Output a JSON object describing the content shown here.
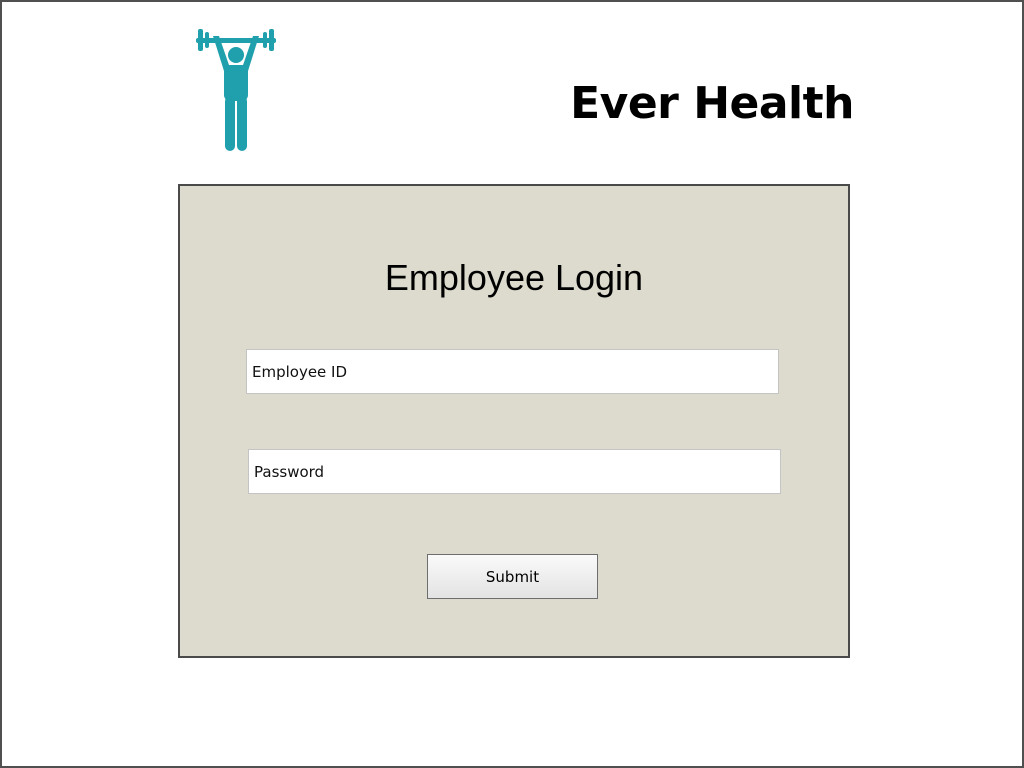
{
  "header": {
    "logo_icon": "weightlifter-icon",
    "logo_color": "#1fa0ac",
    "title": "Ever Health"
  },
  "login": {
    "heading": "Employee Login",
    "employee_id_placeholder": "Employee ID",
    "employee_id_value": "",
    "password_placeholder": "Password",
    "password_value": "",
    "submit_label": "Submit",
    "panel_color": "#dcdbcd"
  }
}
